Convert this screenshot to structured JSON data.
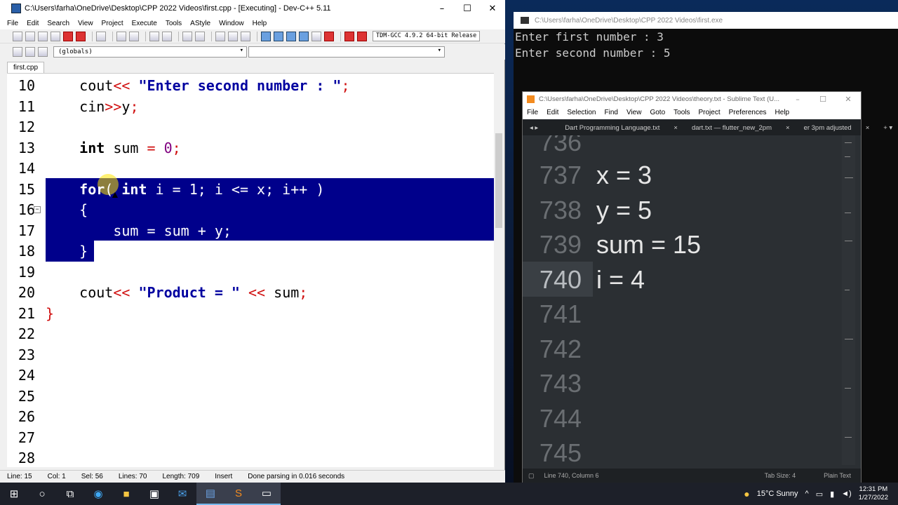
{
  "devcpp": {
    "title": "C:\\Users\\farha\\OneDrive\\Desktop\\CPP 2022 Videos\\first.cpp - [Executing] - Dev-C++ 5.11",
    "menu": [
      "File",
      "Edit",
      "Search",
      "View",
      "Project",
      "Execute",
      "Tools",
      "AStyle",
      "Window",
      "Help"
    ],
    "compiler": "TDM-GCC 4.9.2 64-bit Release",
    "scope_combo": "(globals)",
    "tab": "first.cpp",
    "line_numbers": [
      "10",
      "11",
      "12",
      "13",
      "14",
      "15",
      "16",
      "17",
      "18",
      "19",
      "20",
      "21",
      "22",
      "23",
      "24",
      "25",
      "26",
      "27",
      "28"
    ],
    "status": {
      "line": "Line: 15",
      "col": "Col: 1",
      "sel": "Sel: 56",
      "lines": "Lines: 70",
      "length": "Length: 709",
      "mode": "Insert",
      "message": "Done parsing in 0.016 seconds"
    }
  },
  "console": {
    "title": "C:\\Users\\farha\\OneDrive\\Desktop\\CPP 2022 Videos\\first.exe",
    "lines": [
      "Enter first number : 3",
      "Enter second number : 5"
    ]
  },
  "sublime": {
    "title": "C:\\Users\\farha\\OneDrive\\Desktop\\CPP 2022 Videos\\theory.txt - Sublime Text (U...",
    "menu": [
      "File",
      "Edit",
      "Selection",
      "Find",
      "View",
      "Goto",
      "Tools",
      "Project",
      "Preferences",
      "Help"
    ],
    "tabs": [
      "Dart Programming Language.txt",
      "dart.txt — flutter_new_2pm",
      "er 3pm adjusted"
    ],
    "line_numbers": [
      "736",
      "737",
      "738",
      "739",
      "740",
      "741",
      "742",
      "743",
      "744",
      "745"
    ],
    "lines": [
      "",
      "x = 3",
      "y = 5",
      "sum = 15",
      "i = 4",
      "",
      "",
      "",
      "",
      ""
    ],
    "status_left": "Line 740, Column 6",
    "tab_size": "Tab Size: 4",
    "syntax": "Plain Text"
  },
  "taskbar": {
    "weather": "15°C  Sunny",
    "time": "12:31 PM",
    "date": "1/27/2022"
  },
  "icons": [
    "windows-start-icon",
    "search-icon",
    "task-view-icon",
    "edge-icon",
    "file-explorer-icon",
    "store-icon",
    "mail-icon",
    "devcpp-icon",
    "sublime-icon",
    "console-icon"
  ]
}
